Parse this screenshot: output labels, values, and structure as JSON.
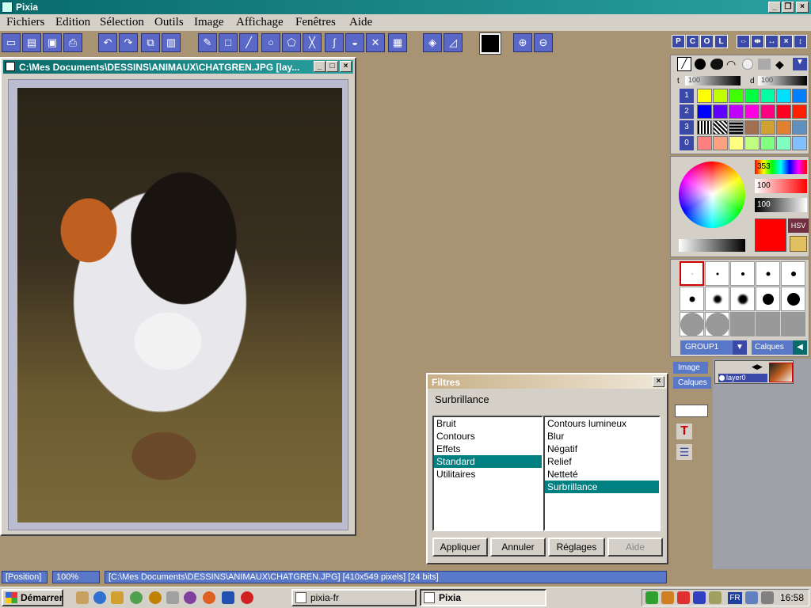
{
  "window": {
    "title": "Pixia"
  },
  "menu": [
    "Fichiers",
    "Edition",
    "Sélection",
    "Outils",
    "Image",
    "Affichage",
    "Fenêtres",
    "Aide"
  ],
  "image_window": {
    "title": "C:\\Mes Documents\\DESSINS\\ANIMAUX\\CHATGREN.JPG [lay..."
  },
  "panels": {
    "top_buttons": [
      "P",
      "C",
      "O",
      "L"
    ],
    "brush_size_label": "t",
    "brush_size_value": "100",
    "density_label": "d",
    "density_value": "100",
    "palette_rows": [
      "1",
      "2",
      "3",
      "0"
    ],
    "hue_value": "353",
    "sat_value": "100",
    "val_value": "100",
    "hsv_button": "HSV",
    "group_select": "GROUP1",
    "calques_button": "Calques",
    "image_tab": "Image",
    "calques_tab": "Calques",
    "layer_name": "layer0",
    "current_color": "#ff0000"
  },
  "dialog": {
    "title": "Filtres",
    "current": "Surbrillance",
    "categories": [
      "Bruit",
      "Contours",
      "Effets",
      "Standard",
      "Utilitaires"
    ],
    "selected_category": 3,
    "filters": [
      "Contours lumineux",
      "Blur",
      "Négatif",
      "Relief",
      "Netteté",
      "Surbrillance"
    ],
    "selected_filter": 5,
    "buttons": {
      "apply": "Appliquer",
      "cancel": "Annuler",
      "settings": "Réglages",
      "help": "Aide"
    },
    "close": "×"
  },
  "statusbar": {
    "position": "[Position]",
    "zoom": "100%",
    "info": "[C:\\Mes Documents\\DESSINS\\ANIMAUX\\CHATGREN.JPG] [410x549 pixels] [24 bits]"
  },
  "taskbar": {
    "start": "Démarrer",
    "tasks": [
      "pixia-fr",
      "Pixia"
    ],
    "language": "FR",
    "clock": "16:58"
  }
}
